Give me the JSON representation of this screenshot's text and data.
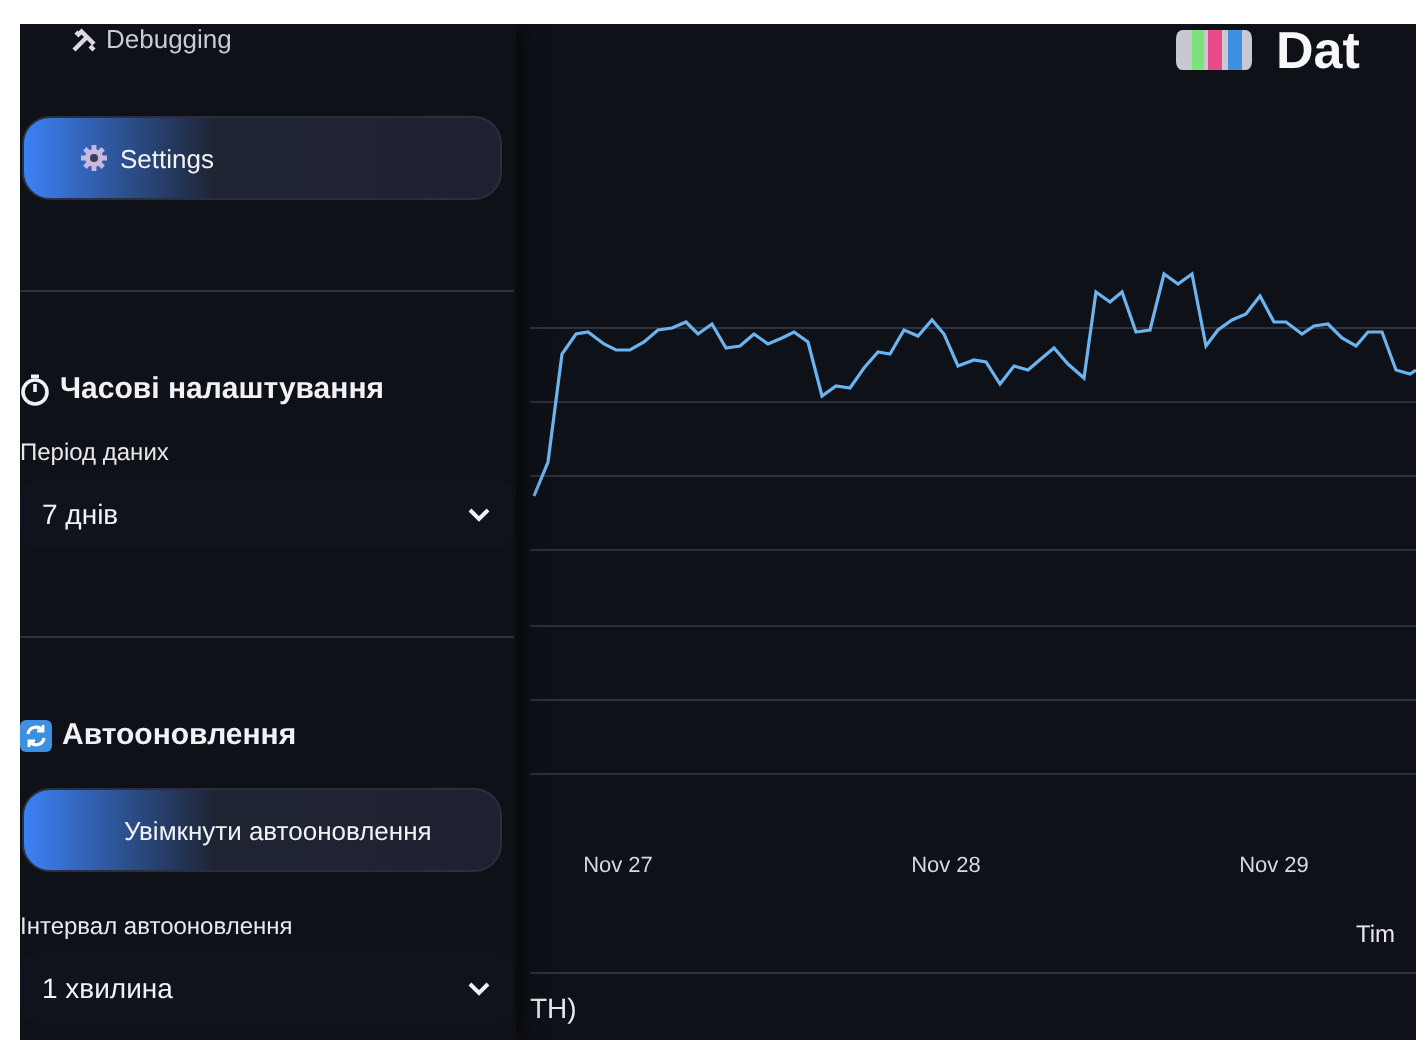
{
  "sidebar": {
    "nav_link": "Debugging",
    "settings_button": "Settings",
    "sections": [
      {
        "kind": "time",
        "title": "Часові налаштування",
        "controls": [
          {
            "kind": "select",
            "label": "Період даних",
            "value": "7 днів"
          }
        ]
      },
      {
        "kind": "refresh",
        "title": "Автооновлення",
        "controls": [
          {
            "kind": "button",
            "label": "Увімкнути автооновлення"
          },
          {
            "kind": "select",
            "label": "Інтервал автооновлення",
            "value": "1 хвилина"
          }
        ]
      }
    ]
  },
  "main": {
    "title": "Dat",
    "chart": {
      "x_ticks": [
        "Nov 27",
        "Nov 28",
        "Nov 29"
      ],
      "x_axis_label": "Tim"
    },
    "footer_text": "TH)"
  }
}
